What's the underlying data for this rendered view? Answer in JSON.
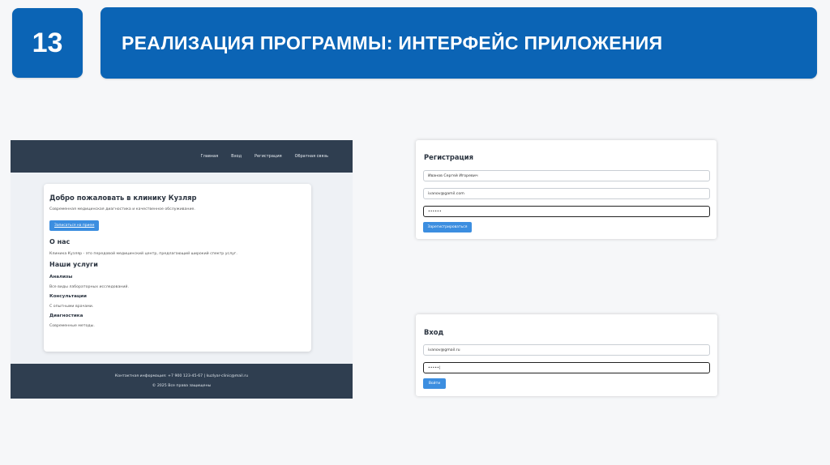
{
  "slide": {
    "number": "13",
    "title": "РЕАЛИЗАЦИЯ ПРОГРАММЫ: ИНТЕРФЕЙС ПРИЛОЖЕНИЯ"
  },
  "site": {
    "nav": [
      "Главная",
      "Вход",
      "Регистрация",
      "Обратная связь"
    ],
    "welcome_title": "Добро пожаловать в клинику Кузляр",
    "welcome_text": "Современная медицинская диагностика и качественное обслуживание.",
    "appointment_button": "Записаться на прием",
    "about_title": "О нас",
    "about_text": "Клиника Кузляр - это передовой медицинский центр, предлагающий широкий спектр услуг.",
    "services_title": "Наши услуги",
    "services": [
      {
        "name": "Анализы",
        "text": "Все виды лабораторных исследований."
      },
      {
        "name": "Консультации",
        "text": "С опытными врачами."
      },
      {
        "name": "Диагностика",
        "text": "Современные методы."
      }
    ],
    "footer_contact": "Контактная информация: +7 900 123-45-67 | kuzlyar-clinic@mail.ru",
    "footer_copyright": "© 2025 Все права защищены"
  },
  "register": {
    "title": "Регистрация",
    "name_value": "Иванов Сергей Игоревич",
    "email_value": "ivanov@gamil.com",
    "password_value": "••••••",
    "submit_label": "Зарегистрироваться"
  },
  "login": {
    "title": "Вход",
    "email_value": "ivanov@gmail.ru",
    "password_value": "•••••|",
    "submit_label": "Войти"
  },
  "colors": {
    "accent": "#0b64b5",
    "site_dark": "#2f3e50",
    "button_blue": "#3c8ee0"
  }
}
